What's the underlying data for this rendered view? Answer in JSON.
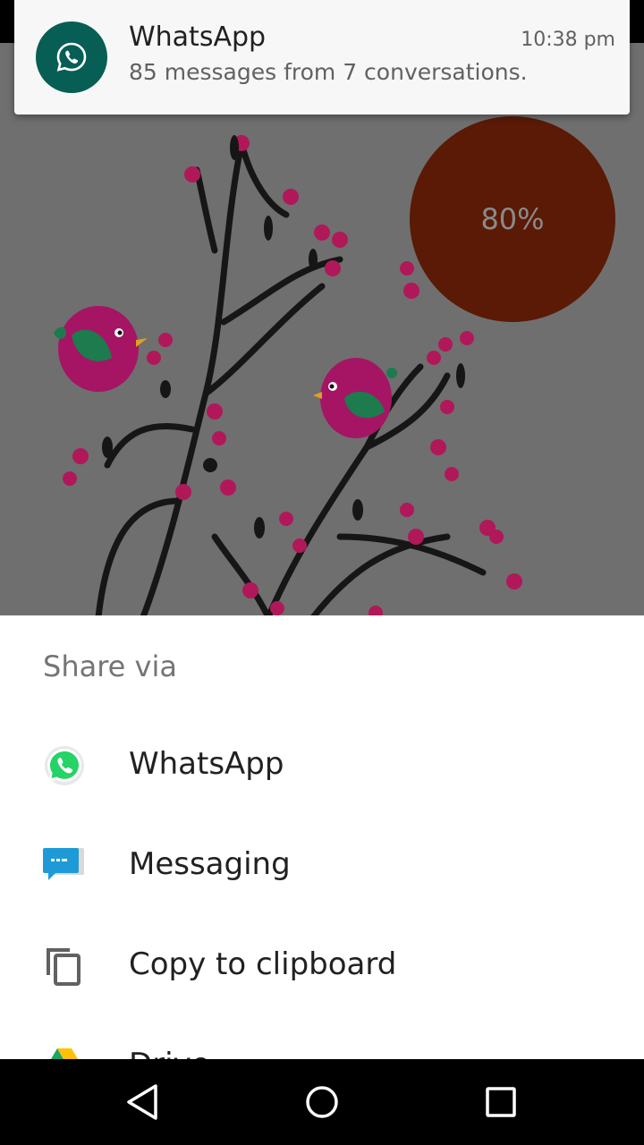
{
  "notification": {
    "app": "WhatsApp",
    "time": "10:38 pm",
    "text": "85 messages from 7 conversations.",
    "icon": "whatsapp-icon"
  },
  "wallpaper": {
    "progress_label": "80%"
  },
  "share_sheet": {
    "title": "Share via",
    "items": [
      {
        "label": "WhatsApp",
        "icon": "whatsapp-icon"
      },
      {
        "label": "Messaging",
        "icon": "messaging-icon"
      },
      {
        "label": "Copy to clipboard",
        "icon": "copy-icon"
      },
      {
        "label": "Drive",
        "icon": "drive-icon"
      }
    ]
  },
  "navbar": {
    "buttons": [
      "back-icon",
      "home-icon",
      "recents-icon"
    ]
  },
  "colors": {
    "whatsapp_dark": "#075e54",
    "whatsapp_green": "#25d366",
    "messaging_blue": "#1e9bd7",
    "sheet_bg": "#ffffff",
    "scrim": "#6f6f6f",
    "progress_circle": "#5a1a05"
  }
}
